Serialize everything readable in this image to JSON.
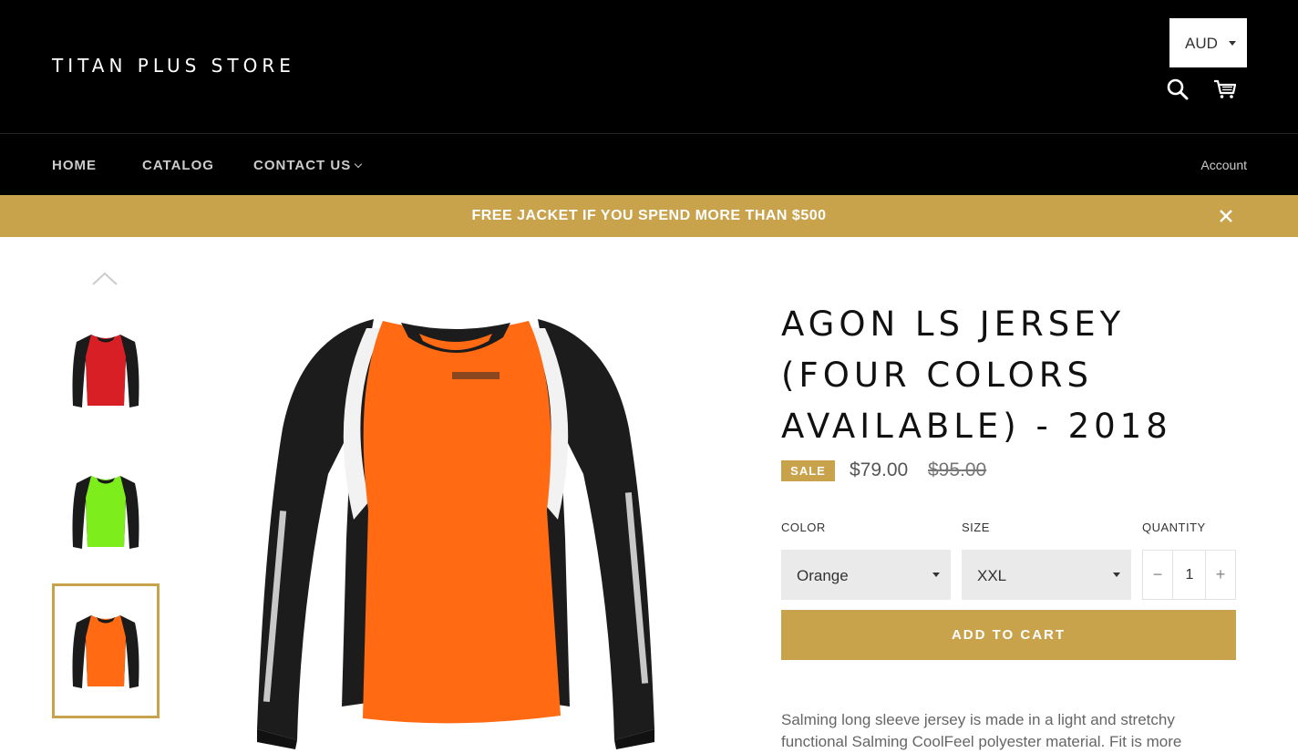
{
  "header": {
    "logo": "TITAN PLUS STORE",
    "currency": "AUD"
  },
  "nav": {
    "home": "HOME",
    "catalog": "CATALOG",
    "contact": "CONTACT US",
    "account": "Account"
  },
  "announcement": {
    "text": "FREE JACKET IF YOU SPEND MORE THAN $500"
  },
  "gallery": {
    "thumbnails": [
      {
        "color_name": "red",
        "hex": "#d91f26"
      },
      {
        "color_name": "green",
        "hex": "#7ded1c"
      },
      {
        "color_name": "orange",
        "hex": "#ff6a13"
      }
    ],
    "active_index": 2
  },
  "product": {
    "title": "AGON LS JERSEY (FOUR COLORS AVAILABLE) - 2018",
    "sale_badge": "SALE",
    "price": "$79.00",
    "compare_price": "$95.00",
    "color_label": "COLOR",
    "color_value": "Orange",
    "size_label": "SIZE",
    "size_value": "XXL",
    "quantity_label": "QUANTITY",
    "quantity_minus": "−",
    "quantity_value": "1",
    "quantity_plus": "+",
    "add_to_cart": "ADD TO CART",
    "description": "Salming long sleeve jersey is made in a light and stretchy functional Salming CoolFeel polyester material. Fit is more"
  },
  "colors": {
    "accent": "#c9a24c",
    "header_bg": "#000000",
    "jersey_orange": "#ff6a13"
  }
}
